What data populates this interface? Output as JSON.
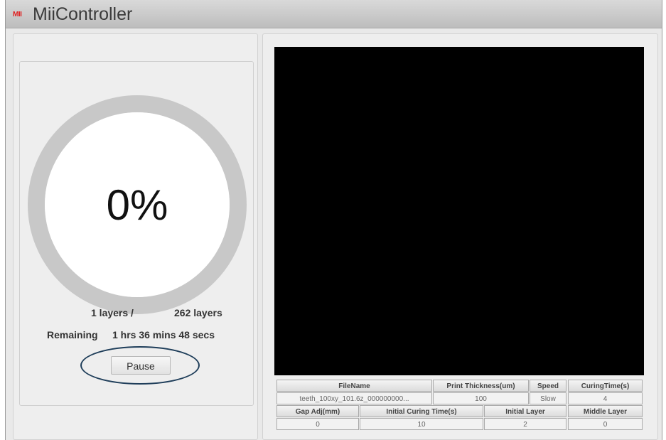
{
  "app": {
    "logo_text": "MII",
    "title": "MiiController"
  },
  "progress": {
    "percent_label": "0%",
    "fraction": 0.0,
    "current_layers": "1 layers /",
    "total_layers": "262 layers",
    "remaining_label": "Remaining",
    "remaining_value": "1 hrs 36 mins 48 secs",
    "pause_label": "Pause"
  },
  "colors": {
    "ring_track": "#c8c8c8",
    "ring_fill": "#ffffff",
    "annotation_circle": "#1f3e5a",
    "preview_bg": "#000000"
  },
  "info": {
    "row1_headers": [
      "FileName",
      "Print Thickness(um)",
      "Speed",
      "CuringTime(s)"
    ],
    "row1_values": [
      "teeth_100xy_101.6z_000000000...",
      "100",
      "Slow",
      "4"
    ],
    "row2_headers": [
      "Gap Adj(mm)",
      "Initial Curing Time(s)",
      "Initial Layer",
      "Middle Layer"
    ],
    "row2_values": [
      "0",
      "10",
      "2",
      "0"
    ]
  }
}
